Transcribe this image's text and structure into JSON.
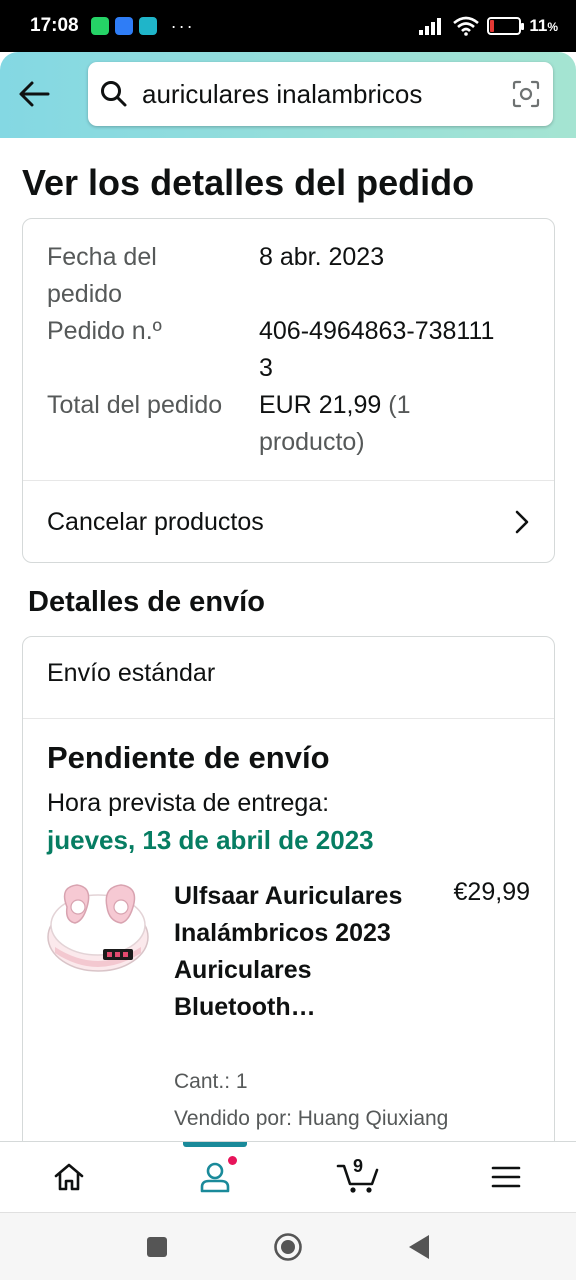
{
  "status_bar": {
    "time": "17:08",
    "overflow": "···",
    "battery": "11",
    "battery_unit": "%",
    "battery_level": 0.11,
    "icons": [
      "whatsapp-icon",
      "messages-icon",
      "pinyin-app-icon",
      "signal-icon",
      "wifi-icon",
      "battery-icon"
    ]
  },
  "search": {
    "query": "auriculares inalambricos"
  },
  "page": {
    "title": "Ver los detalles del pedido"
  },
  "order": {
    "rows": [
      {
        "label": "Fecha del pedido",
        "value": "8 abr. 2023"
      },
      {
        "label": "Pedido n.º",
        "value": "406-4964863-7381113"
      },
      {
        "label": "Total del pedido",
        "value": "EUR 21,99",
        "value_extra": "(1 producto)"
      }
    ],
    "cancel_label": "Cancelar productos"
  },
  "shipping": {
    "section_title": "Detalles de envío",
    "type": "Envío estándar",
    "status": "Pendiente de envío",
    "eta_label": "Hora prevista de entrega:",
    "eta_date": "jueves, 13 de abril de 2023",
    "product": {
      "title": "Ulfsaar Auriculares Inalámbricos 2023 Auriculares Bluetooth…",
      "price": "€29,99",
      "qty": "Cant.: 1",
      "seller": "Vendido por: Huang Qiuxiang"
    }
  },
  "bottom_nav": {
    "cart_count": "9",
    "items": [
      "home-icon",
      "account-icon",
      "cart-icon",
      "menu-icon"
    ]
  },
  "colors": {
    "header_gradient_start": "#84d8e3",
    "header_gradient_end": "#a5e4d2",
    "eta_green": "#067d62",
    "nav_accent": "#1a8a9a",
    "notification_dot": "#e7145a"
  }
}
